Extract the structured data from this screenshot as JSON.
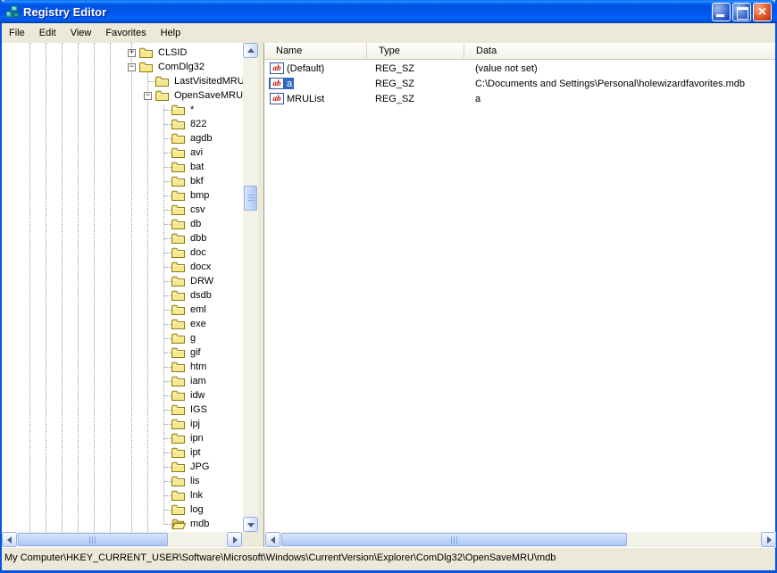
{
  "window": {
    "title": "Registry Editor",
    "controls": {
      "minimize": "minimize",
      "maximize": "maximize",
      "close": "close"
    }
  },
  "menu": {
    "items": [
      "File",
      "Edit",
      "View",
      "Favorites",
      "Help"
    ]
  },
  "tree": {
    "items": [
      {
        "label": "CLSID",
        "level": 0,
        "expander": "plus",
        "icon": "closed",
        "selected": false
      },
      {
        "label": "ComDlg32",
        "level": 0,
        "expander": "minus",
        "icon": "closed",
        "selected": false
      },
      {
        "label": "LastVisitedMRU",
        "level": 1,
        "expander": null,
        "icon": "closed",
        "selected": false
      },
      {
        "label": "OpenSaveMRU",
        "level": 1,
        "expander": "minus",
        "icon": "closed",
        "selected": false
      },
      {
        "label": "*",
        "level": 2,
        "expander": null,
        "icon": "closed",
        "selected": false
      },
      {
        "label": "822",
        "level": 2,
        "expander": null,
        "icon": "closed",
        "selected": false
      },
      {
        "label": "agdb",
        "level": 2,
        "expander": null,
        "icon": "closed",
        "selected": false
      },
      {
        "label": "avi",
        "level": 2,
        "expander": null,
        "icon": "closed",
        "selected": false
      },
      {
        "label": "bat",
        "level": 2,
        "expander": null,
        "icon": "closed",
        "selected": false
      },
      {
        "label": "bkf",
        "level": 2,
        "expander": null,
        "icon": "closed",
        "selected": false
      },
      {
        "label": "bmp",
        "level": 2,
        "expander": null,
        "icon": "closed",
        "selected": false
      },
      {
        "label": "csv",
        "level": 2,
        "expander": null,
        "icon": "closed",
        "selected": false
      },
      {
        "label": "db",
        "level": 2,
        "expander": null,
        "icon": "closed",
        "selected": false
      },
      {
        "label": "dbb",
        "level": 2,
        "expander": null,
        "icon": "closed",
        "selected": false
      },
      {
        "label": "doc",
        "level": 2,
        "expander": null,
        "icon": "closed",
        "selected": false
      },
      {
        "label": "docx",
        "level": 2,
        "expander": null,
        "icon": "closed",
        "selected": false
      },
      {
        "label": "DRW",
        "level": 2,
        "expander": null,
        "icon": "closed",
        "selected": false
      },
      {
        "label": "dsdb",
        "level": 2,
        "expander": null,
        "icon": "closed",
        "selected": false
      },
      {
        "label": "eml",
        "level": 2,
        "expander": null,
        "icon": "closed",
        "selected": false
      },
      {
        "label": "exe",
        "level": 2,
        "expander": null,
        "icon": "closed",
        "selected": false
      },
      {
        "label": "g",
        "level": 2,
        "expander": null,
        "icon": "closed",
        "selected": false
      },
      {
        "label": "gif",
        "level": 2,
        "expander": null,
        "icon": "closed",
        "selected": false
      },
      {
        "label": "htm",
        "level": 2,
        "expander": null,
        "icon": "closed",
        "selected": false
      },
      {
        "label": "iam",
        "level": 2,
        "expander": null,
        "icon": "closed",
        "selected": false
      },
      {
        "label": "idw",
        "level": 2,
        "expander": null,
        "icon": "closed",
        "selected": false
      },
      {
        "label": "IGS",
        "level": 2,
        "expander": null,
        "icon": "closed",
        "selected": false
      },
      {
        "label": "ipj",
        "level": 2,
        "expander": null,
        "icon": "closed",
        "selected": false
      },
      {
        "label": "ipn",
        "level": 2,
        "expander": null,
        "icon": "closed",
        "selected": false
      },
      {
        "label": "ipt",
        "level": 2,
        "expander": null,
        "icon": "closed",
        "selected": false
      },
      {
        "label": "JPG",
        "level": 2,
        "expander": null,
        "icon": "closed",
        "selected": false
      },
      {
        "label": "lis",
        "level": 2,
        "expander": null,
        "icon": "closed",
        "selected": false
      },
      {
        "label": "lnk",
        "level": 2,
        "expander": null,
        "icon": "closed",
        "selected": false
      },
      {
        "label": "log",
        "level": 2,
        "expander": null,
        "icon": "closed",
        "selected": false
      },
      {
        "label": "mdb",
        "level": 2,
        "expander": null,
        "icon": "open",
        "selected": true
      }
    ]
  },
  "list": {
    "columns": [
      "Name",
      "Type",
      "Data"
    ],
    "rows": [
      {
        "name": "(Default)",
        "type": "REG_SZ",
        "data": "(value not set)",
        "selected": false
      },
      {
        "name": "a",
        "type": "REG_SZ",
        "data": "C:\\Documents and Settings\\Personal\\holewizardfavorites.mdb",
        "selected": true
      },
      {
        "name": "MRUList",
        "type": "REG_SZ",
        "data": "a",
        "selected": false
      }
    ]
  },
  "statusbar": {
    "path": "My Computer\\HKEY_CURRENT_USER\\Software\\Microsoft\\Windows\\CurrentVersion\\Explorer\\ComDlg32\\OpenSaveMRU\\mdb"
  },
  "colors": {
    "titlebar_blue": "#0054E3",
    "selection_blue": "#316AC5",
    "chrome_beige": "#ECE9D8",
    "folder_yellow": "#F4E98F",
    "value_icon_red": "#B50909"
  }
}
